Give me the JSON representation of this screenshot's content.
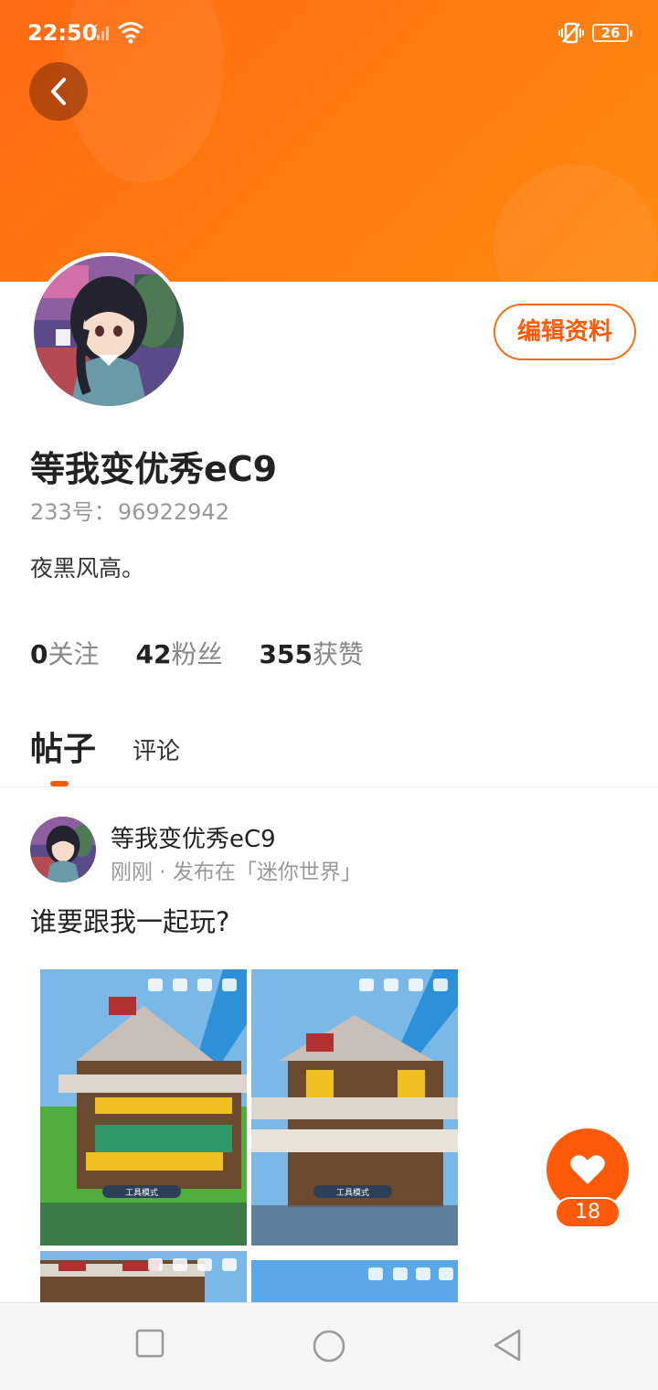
{
  "status_bar": {
    "time": "22:50",
    "battery": "26"
  },
  "profile": {
    "edit_button": "编辑资料",
    "username": "等我变优秀eC9",
    "id_label": "233号：",
    "id_value": "96922942",
    "bio": "夜黑风高。",
    "stats": [
      {
        "value": "0",
        "label": "关注"
      },
      {
        "value": "42",
        "label": "粉丝"
      },
      {
        "value": "355",
        "label": "获赞"
      }
    ]
  },
  "tabs": [
    {
      "label": "帖子",
      "active": true
    },
    {
      "label": "评论",
      "active": false
    }
  ],
  "post": {
    "author": "等我变优秀eC9",
    "meta": "刚刚 · 发布在「迷你世界」",
    "text": "谁要跟我一起玩?",
    "images": [
      {
        "caption": "工具模式"
      },
      {
        "caption": "工具模式"
      },
      {
        "caption": ""
      },
      {
        "caption": ""
      }
    ]
  },
  "like": {
    "count": "18"
  },
  "colors": {
    "accent": "#ff5a0a",
    "banner": "#ff7a0f"
  },
  "icons": [
    "back-arrow-icon",
    "heart-icon",
    "wifi-icon",
    "signal-icon",
    "vibrate-icon",
    "square-nav-icon",
    "circle-nav-icon",
    "triangle-back-icon"
  ]
}
